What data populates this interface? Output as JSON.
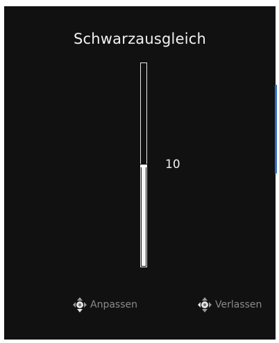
{
  "osd": {
    "title": "Schwarzausgleich",
    "value_text": "10",
    "slider": {
      "value": 10,
      "min": 0,
      "max": 20
    }
  },
  "hints": {
    "adjust_label": "Anpassen",
    "exit_label": "Verlassen",
    "adjust_icon": "joystick-updown-icon",
    "exit_icon": "joystick-left-icon"
  },
  "colors": {
    "panel_bg": "#111111",
    "text": "#f2f2f2",
    "hint_text": "#8a8a8a",
    "accent": "#2a73c7"
  }
}
